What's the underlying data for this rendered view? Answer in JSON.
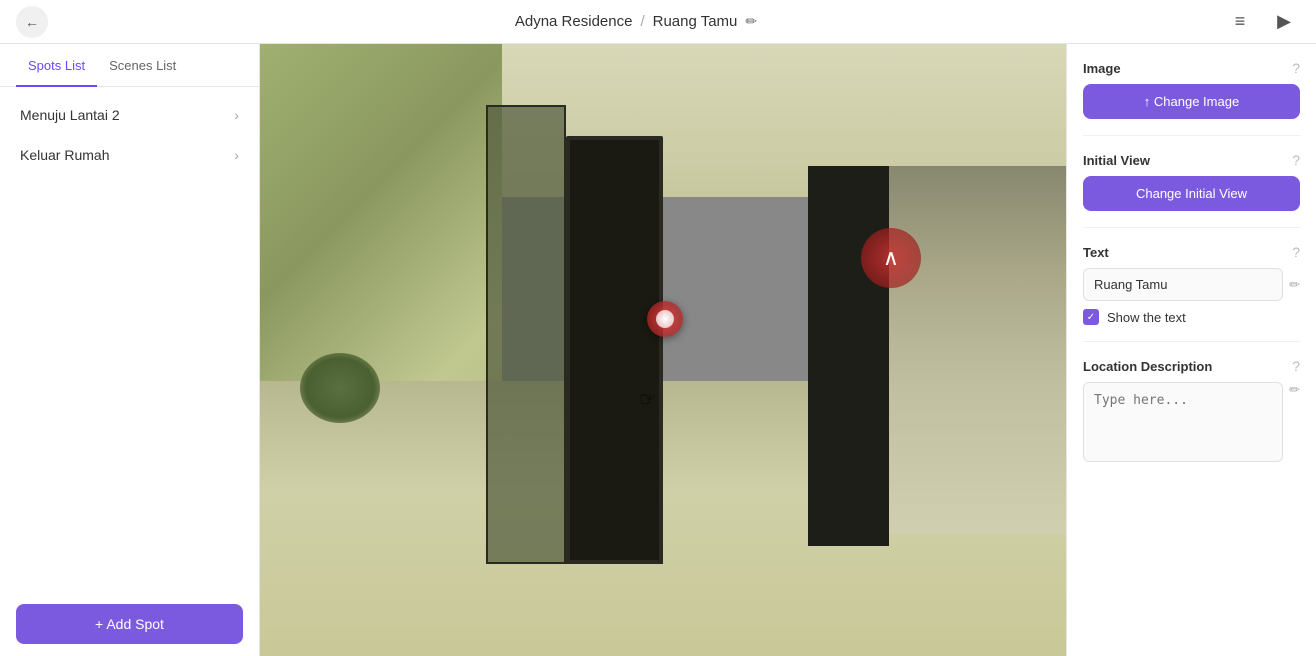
{
  "header": {
    "back_icon": "←",
    "project_name": "Adyna Residence",
    "separator": "/",
    "scene_name": "Ruang Tamu",
    "edit_icon": "✏",
    "list_icon": "≡",
    "play_icon": "▶"
  },
  "sidebar": {
    "tab_spots": "Spots List",
    "tab_scenes": "Scenes List",
    "items": [
      {
        "label": "Menuju Lantai 2",
        "chevron": "›"
      },
      {
        "label": "Keluar Rumah",
        "chevron": "›"
      }
    ],
    "add_spot_label": "+ Add Spot"
  },
  "right_panel": {
    "image_section": {
      "title": "Image",
      "help_icon": "?",
      "change_image_label": "↑ Change Image"
    },
    "initial_view_section": {
      "title": "Initial View",
      "help_icon": "?",
      "change_view_label": "Change Initial View"
    },
    "text_section": {
      "title": "Text",
      "help_icon": "?",
      "text_value": "Ruang Tamu",
      "text_placeholder": "Ruang Tamu",
      "edit_icon": "✏",
      "show_text_label": "Show the text",
      "show_text_checked": true
    },
    "location_section": {
      "title": "Location Description",
      "help_icon": "?",
      "placeholder": "Type here...",
      "edit_icon": "✏"
    }
  }
}
